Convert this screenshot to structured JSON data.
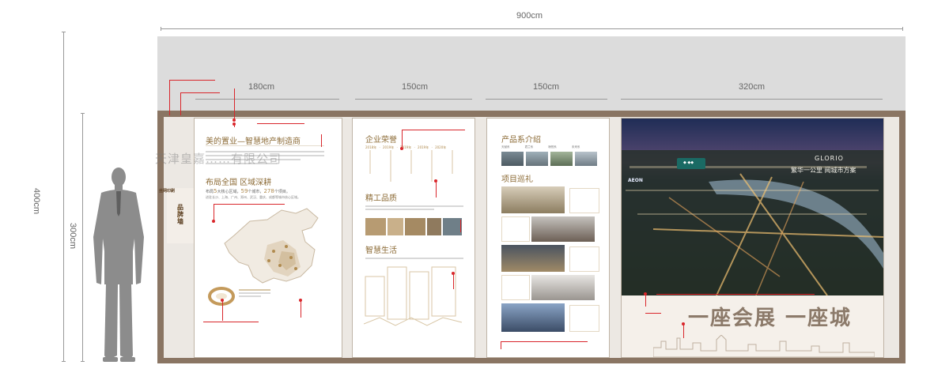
{
  "dimensions": {
    "total_width": "900cm",
    "height_400": "400cm",
    "height_300": "300cm",
    "segments": [
      "180cm",
      "150cm",
      "150cm",
      "320cm"
    ]
  },
  "watermark": "天津皇嘉……有限公司",
  "side_sign": {
    "small": "丝网印刷",
    "title": "品牌墙",
    "en": "BRAND WALL"
  },
  "panel1": {
    "title": "美的置业—智慧地产制造商",
    "section2": "布局全国 区域深耕",
    "stats_prefix": "布局",
    "stat1": "5",
    "stat1_unit": "大核心区域，",
    "stat2": "59",
    "stat2_unit": "个城市，",
    "stat3": "278",
    "stat3_unit": "个项目。",
    "cities": "进驻长沙、上海、广州、郑州、武汉、重庆、成都等城市核心区域。"
  },
  "panel2": {
    "title1": "企业荣誉",
    "years": [
      "2018年",
      "2019年",
      "2019年",
      "2019年",
      "2020年"
    ],
    "title2": "精工品质",
    "title3": "智慧生活"
  },
  "panel3": {
    "title1": "产品系介绍",
    "series": [
      "天赋系",
      "君兰系",
      "璟悦系",
      "未来系"
    ],
    "title2": "项目巡礼"
  },
  "panel4": {
    "slogan": "繁华一公里  阅城市方案",
    "brand": "GLORIO",
    "bottom_slogan": "一座会展 一座城",
    "aeon": "AEON"
  },
  "colors": {
    "wall": "#8a7563",
    "gold": "#b08b4f",
    "annotation": "#d9262b",
    "ceiling": "#dcdcdc"
  }
}
